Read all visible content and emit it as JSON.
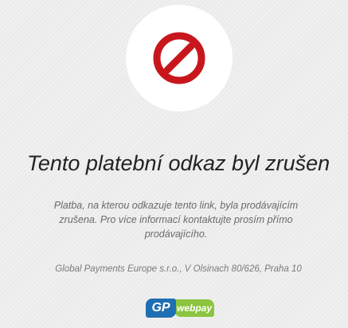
{
  "status_icon": "prohibited-icon",
  "title": "Tento platební odkaz byl zrušen",
  "message": "Platba, na kterou odkazuje tento link, byla prodávajícím zrušena. Pro více informací kontaktujte prosím přímo prodávajícího.",
  "footer": {
    "company": "Global Payments Europe s.r.o., V Olsinach 80/626, Praha 10"
  },
  "logo": {
    "part1": "GP",
    "part2": "webpay"
  },
  "colors": {
    "background": "#ebebeb",
    "icon_red": "#c8161d",
    "logo_blue": "#1f6fb3",
    "logo_green": "#8cc53f",
    "title_text": "#222222"
  }
}
